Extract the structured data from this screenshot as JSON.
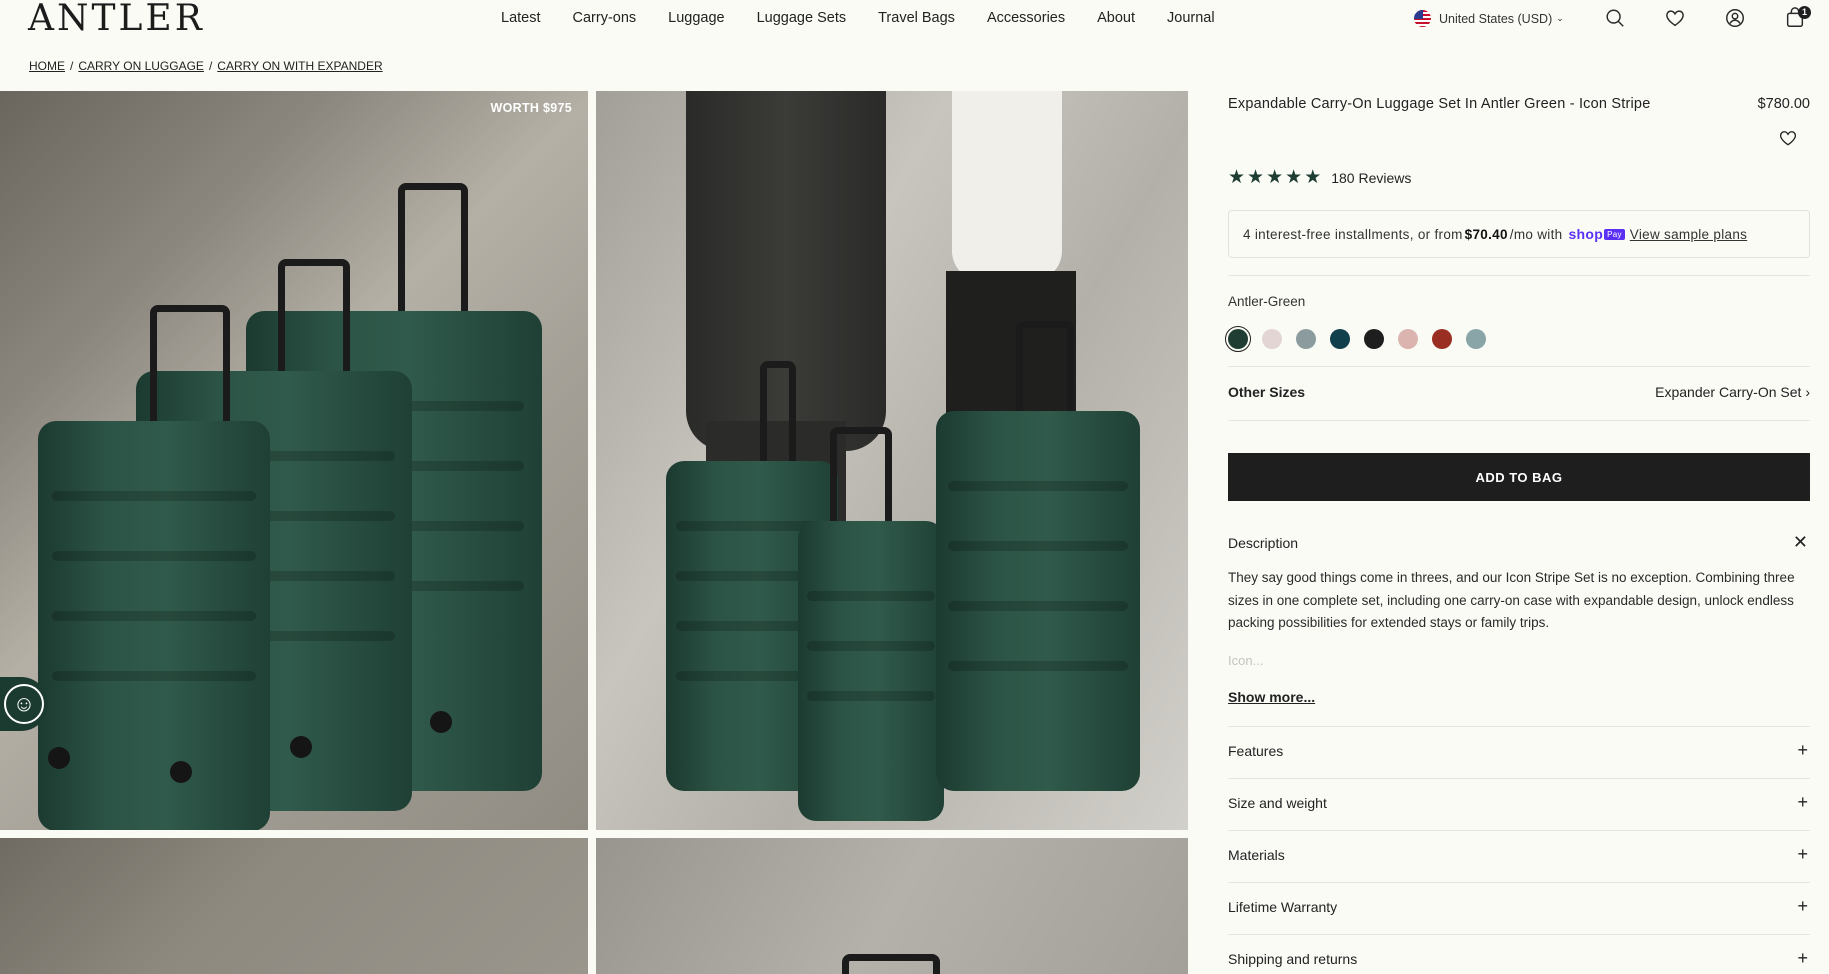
{
  "brand": "ANTLER",
  "nav": [
    "Latest",
    "Carry-ons",
    "Luggage",
    "Luggage Sets",
    "Travel Bags",
    "Accessories",
    "About",
    "Journal"
  ],
  "region": {
    "label": "United States (USD)"
  },
  "cart_count": "1",
  "breadcrumb": [
    "HOME",
    "CARRY ON LUGGAGE",
    "CARRY ON WITH EXPANDER"
  ],
  "breadcrumb_sep": "/",
  "gallery": {
    "badge": "WORTH $975"
  },
  "product": {
    "title": "Expandable Carry-On Luggage Set In Antler Green - Icon Stripe",
    "price": "$780.00",
    "rating_value": 5,
    "reviews": "180 Reviews",
    "installments_prefix": "4 interest-free installments, or from",
    "installments_amount": "$70.40",
    "installments_suffix": "/mo with",
    "shop_label": "shop",
    "pay_label": "Pay",
    "sample_plans": "View sample plans",
    "color_name": "Antler-Green",
    "swatches": [
      "#1f3d33",
      "#e2d5d4",
      "#8c9c9e",
      "#123f4c",
      "#1e1e1e",
      "#dbb4b0",
      "#9a2e22",
      "#8aa5a8"
    ],
    "other_sizes_label": "Other Sizes",
    "other_sizes_value": "Expander Carry-On Set",
    "add_to_bag": "ADD TO BAG",
    "description_label": "Description",
    "description_text": "They say good things come in threes, and our Icon Stripe Set is no exception. Combining three sizes in one complete set, including one carry-on case with expandable design, unlock endless packing possibilities for extended stays or family trips.",
    "description_fade": "Icon...",
    "show_more": "Show more...",
    "accordions": [
      "Features",
      "Size and weight",
      "Materials",
      "Lifetime Warranty",
      "Shipping and returns"
    ]
  }
}
